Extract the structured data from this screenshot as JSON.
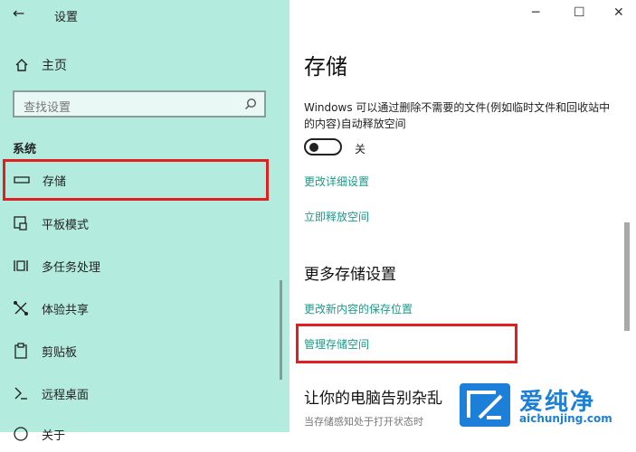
{
  "window": {
    "title": "设置",
    "back_glyph": "←",
    "minimize_glyph": "─",
    "maximize_glyph": "☐",
    "close_glyph": "✕"
  },
  "sidebar": {
    "home_label": "主页",
    "search_placeholder": "查找设置",
    "section_title": "系统",
    "items": [
      {
        "label": "存储",
        "icon": "storage-icon",
        "selected": true
      },
      {
        "label": "平板模式",
        "icon": "tablet-mode-icon"
      },
      {
        "label": "多任务处理",
        "icon": "multitasking-icon"
      },
      {
        "label": "体验共享",
        "icon": "shared-experiences-icon"
      },
      {
        "label": "剪贴板",
        "icon": "clipboard-icon"
      },
      {
        "label": "远程桌面",
        "icon": "remote-desktop-icon"
      },
      {
        "label": "关于",
        "icon": "about-icon"
      }
    ]
  },
  "main": {
    "title": "存储",
    "description": "Windows 可以通过删除不需要的文件(例如临时文件和回收站中的内容)自动释放空间",
    "toggle_state": "关",
    "links": [
      "更改详细设置",
      "立即释放空间"
    ],
    "more_heading": "更多存储设置",
    "more_links": [
      "更改新内容的保存位置",
      "管理存储空间"
    ],
    "next_heading": "让你的电脑告别杂乱",
    "next_hint": "当存储感知处于打开状态时"
  },
  "watermark": {
    "text": "爱纯净",
    "url": "aichunjing.com"
  },
  "colors": {
    "sidebar_bg": "#b3ecdf",
    "link": "#1a9a8a",
    "highlight": "#e02020",
    "watermark": "#1c7fd8"
  }
}
